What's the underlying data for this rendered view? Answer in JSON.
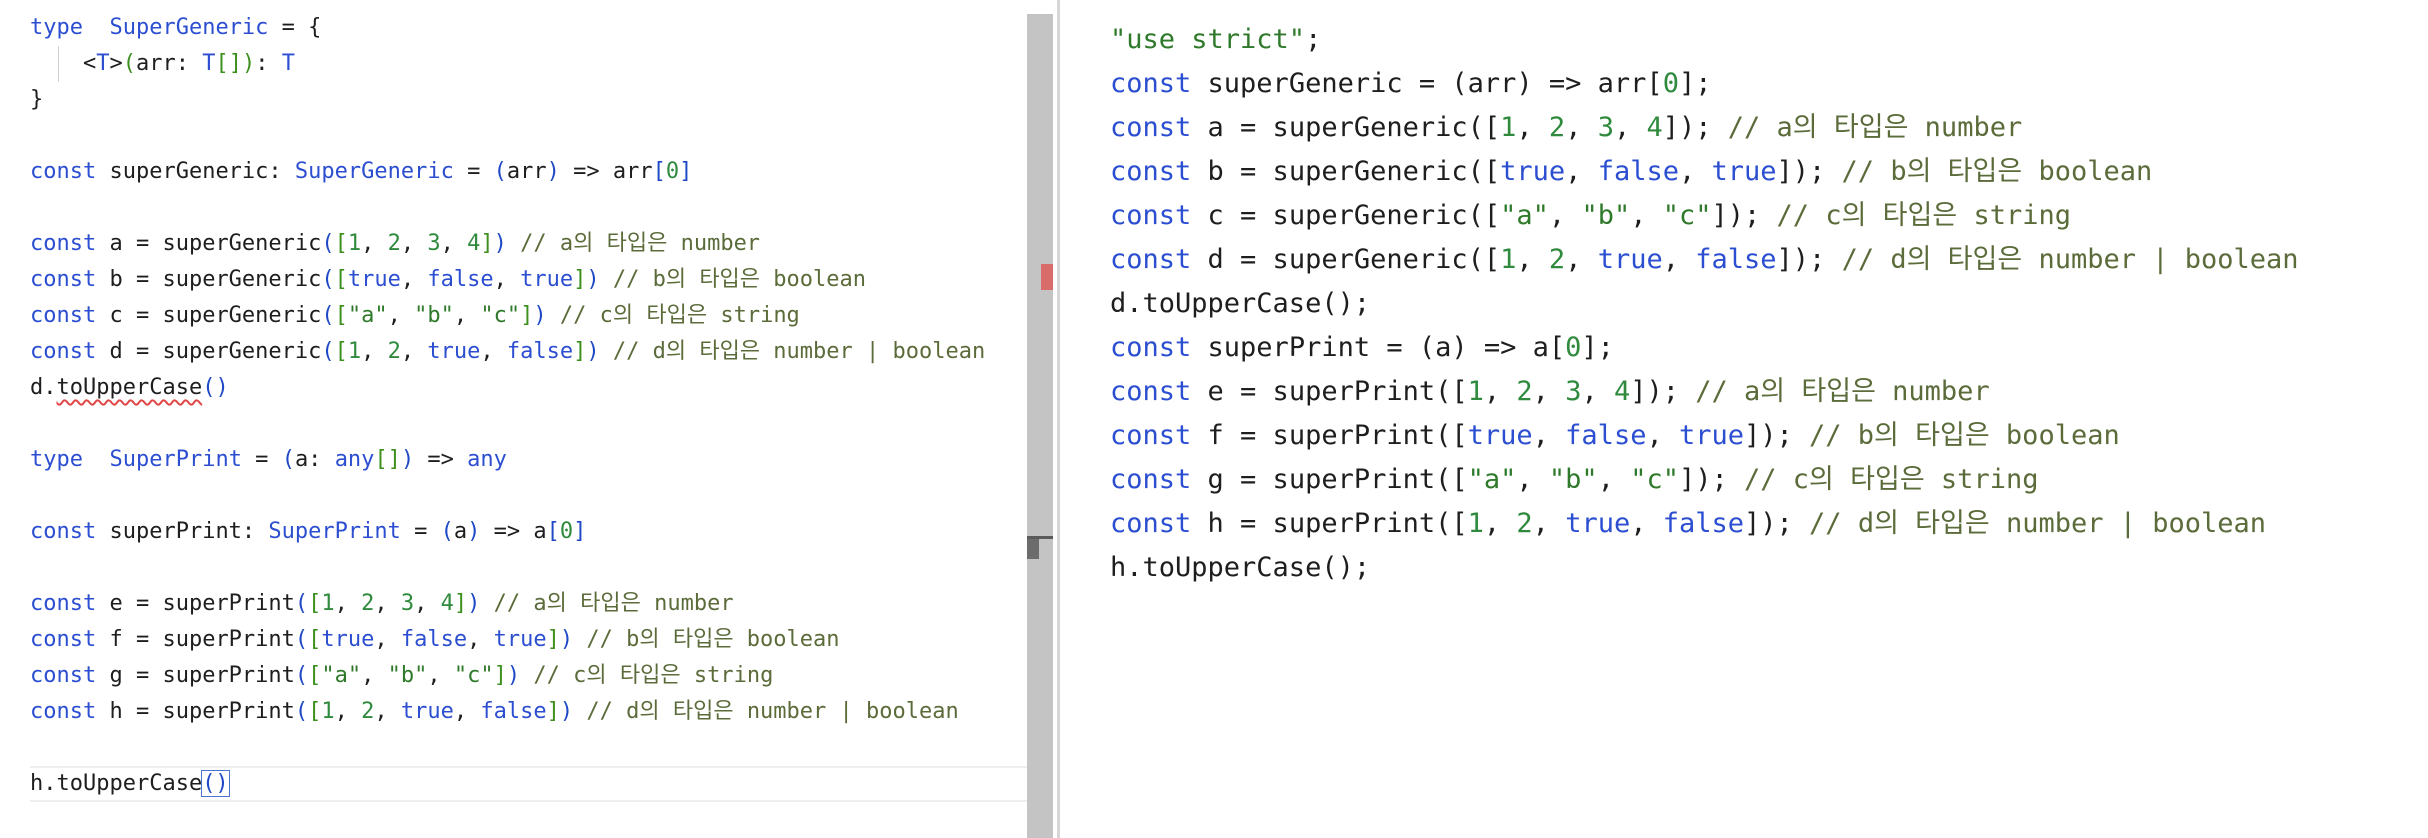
{
  "ts_editor": {
    "lines": [
      [
        [
          "kw",
          "type"
        ],
        [
          "",
          "  "
        ],
        [
          "ty",
          "SuperGeneric"
        ],
        [
          "",
          " = {"
        ]
      ],
      [
        [
          "",
          "    <"
        ],
        [
          "ty",
          "T"
        ],
        [
          "",
          ">"
        ],
        [
          "br2",
          "("
        ],
        [
          "",
          "arr: "
        ],
        [
          "ty",
          "T"
        ],
        [
          "br2",
          "[]"
        ],
        [
          "br2",
          ")"
        ],
        [
          "",
          ": "
        ],
        [
          "ty",
          "T"
        ]
      ],
      [
        [
          "",
          "}"
        ]
      ],
      [],
      [
        [
          "kw",
          "const"
        ],
        [
          "",
          " superGeneric: "
        ],
        [
          "ty",
          "SuperGeneric"
        ],
        [
          "",
          " = "
        ],
        [
          "br1",
          "("
        ],
        [
          "",
          "arr"
        ],
        [
          "br1",
          ")"
        ],
        [
          "",
          " => arr"
        ],
        [
          "br1",
          "["
        ],
        [
          "num",
          "0"
        ],
        [
          "br1",
          "]"
        ]
      ],
      [],
      [
        [
          "kw",
          "const"
        ],
        [
          "",
          " a = superGeneric"
        ],
        [
          "br1",
          "("
        ],
        [
          "br2",
          "["
        ],
        [
          "num",
          "1"
        ],
        [
          "",
          ", "
        ],
        [
          "num",
          "2"
        ],
        [
          "",
          ", "
        ],
        [
          "num",
          "3"
        ],
        [
          "",
          ", "
        ],
        [
          "num",
          "4"
        ],
        [
          "br2",
          "]"
        ],
        [
          "br1",
          ")"
        ],
        [
          "cmt",
          " // a의 타입은 number"
        ]
      ],
      [
        [
          "kw",
          "const"
        ],
        [
          "",
          " b = superGeneric"
        ],
        [
          "br1",
          "("
        ],
        [
          "br2",
          "["
        ],
        [
          "kw",
          "true"
        ],
        [
          "",
          ", "
        ],
        [
          "kw",
          "false"
        ],
        [
          "",
          ", "
        ],
        [
          "kw",
          "true"
        ],
        [
          "br2",
          "]"
        ],
        [
          "br1",
          ")"
        ],
        [
          "cmt",
          " // b의 타입은 boolean"
        ]
      ],
      [
        [
          "kw",
          "const"
        ],
        [
          "",
          " c = superGeneric"
        ],
        [
          "br1",
          "("
        ],
        [
          "br2",
          "["
        ],
        [
          "str",
          "\"a\""
        ],
        [
          "",
          ", "
        ],
        [
          "str",
          "\"b\""
        ],
        [
          "",
          ", "
        ],
        [
          "str",
          "\"c\""
        ],
        [
          "br2",
          "]"
        ],
        [
          "br1",
          ")"
        ],
        [
          "cmt",
          " // c의 타입은 string"
        ]
      ],
      [
        [
          "kw",
          "const"
        ],
        [
          "",
          " d = superGeneric"
        ],
        [
          "br1",
          "("
        ],
        [
          "br2",
          "["
        ],
        [
          "num",
          "1"
        ],
        [
          "",
          ", "
        ],
        [
          "num",
          "2"
        ],
        [
          "",
          ", "
        ],
        [
          "kw",
          "true"
        ],
        [
          "",
          ", "
        ],
        [
          "kw",
          "false"
        ],
        [
          "br2",
          "]"
        ],
        [
          "br1",
          ")"
        ],
        [
          "cmt",
          " // d의 타입은 number | boolean"
        ]
      ],
      [
        [
          "",
          "d."
        ],
        [
          "squiggle",
          "toUpperCase"
        ],
        [
          "br1",
          "()"
        ]
      ],
      [],
      [
        [
          "kw",
          "type"
        ],
        [
          "",
          "  "
        ],
        [
          "ty",
          "SuperPrint"
        ],
        [
          "",
          " = "
        ],
        [
          "br1",
          "("
        ],
        [
          "",
          "a: "
        ],
        [
          "ty",
          "any"
        ],
        [
          "br2",
          "[]"
        ],
        [
          "br1",
          ")"
        ],
        [
          "",
          " => "
        ],
        [
          "ty",
          "any"
        ]
      ],
      [],
      [
        [
          "kw",
          "const"
        ],
        [
          "",
          " superPrint: "
        ],
        [
          "ty",
          "SuperPrint"
        ],
        [
          "",
          " = "
        ],
        [
          "br1",
          "("
        ],
        [
          "",
          "a"
        ],
        [
          "br1",
          ")"
        ],
        [
          "",
          " => a"
        ],
        [
          "br1",
          "["
        ],
        [
          "num",
          "0"
        ],
        [
          "br1",
          "]"
        ]
      ],
      [],
      [
        [
          "kw",
          "const"
        ],
        [
          "",
          " e = superPrint"
        ],
        [
          "br1",
          "("
        ],
        [
          "br2",
          "["
        ],
        [
          "num",
          "1"
        ],
        [
          "",
          ", "
        ],
        [
          "num",
          "2"
        ],
        [
          "",
          ", "
        ],
        [
          "num",
          "3"
        ],
        [
          "",
          ", "
        ],
        [
          "num",
          "4"
        ],
        [
          "br2",
          "]"
        ],
        [
          "br1",
          ")"
        ],
        [
          "cmt",
          " // a의 타입은 number"
        ]
      ],
      [
        [
          "kw",
          "const"
        ],
        [
          "",
          " f = superPrint"
        ],
        [
          "br1",
          "("
        ],
        [
          "br2",
          "["
        ],
        [
          "kw",
          "true"
        ],
        [
          "",
          ", "
        ],
        [
          "kw",
          "false"
        ],
        [
          "",
          ", "
        ],
        [
          "kw",
          "true"
        ],
        [
          "br2",
          "]"
        ],
        [
          "br1",
          ")"
        ],
        [
          "cmt",
          " // b의 타입은 boolean"
        ]
      ],
      [
        [
          "kw",
          "const"
        ],
        [
          "",
          " g = superPrint"
        ],
        [
          "br1",
          "("
        ],
        [
          "br2",
          "["
        ],
        [
          "str",
          "\"a\""
        ],
        [
          "",
          ", "
        ],
        [
          "str",
          "\"b\""
        ],
        [
          "",
          ", "
        ],
        [
          "str",
          "\"c\""
        ],
        [
          "br2",
          "]"
        ],
        [
          "br1",
          ")"
        ],
        [
          "cmt",
          " // c의 타입은 string"
        ]
      ],
      [
        [
          "kw",
          "const"
        ],
        [
          "",
          " h = superPrint"
        ],
        [
          "br1",
          "("
        ],
        [
          "br2",
          "["
        ],
        [
          "num",
          "1"
        ],
        [
          "",
          ", "
        ],
        [
          "num",
          "2"
        ],
        [
          "",
          ", "
        ],
        [
          "kw",
          "true"
        ],
        [
          "",
          ", "
        ],
        [
          "kw",
          "false"
        ],
        [
          "br2",
          "]"
        ],
        [
          "br1",
          ")"
        ],
        [
          "cmt",
          " // d의 타입은 number | boolean"
        ]
      ],
      [],
      [
        [
          "",
          "h.toUpperCase"
        ],
        [
          "caret",
          "()"
        ]
      ]
    ]
  },
  "js_output": {
    "lines": [
      [
        [
          "str",
          "\"use strict\""
        ],
        [
          "",
          ";"
        ]
      ],
      [
        [
          "kw",
          "const"
        ],
        [
          "",
          " superGeneric = (arr) => arr["
        ],
        [
          "num",
          "0"
        ],
        [
          "",
          "];"
        ]
      ],
      [
        [
          "kw",
          "const"
        ],
        [
          "",
          " a = superGeneric(["
        ],
        [
          "num",
          "1"
        ],
        [
          "",
          ", "
        ],
        [
          "num",
          "2"
        ],
        [
          "",
          ", "
        ],
        [
          "num",
          "3"
        ],
        [
          "",
          ", "
        ],
        [
          "num",
          "4"
        ],
        [
          "",
          "]);"
        ],
        [
          "cmt",
          " // a의 타입은 number"
        ]
      ],
      [
        [
          "kw",
          "const"
        ],
        [
          "",
          " b = superGeneric(["
        ],
        [
          "kw",
          "true"
        ],
        [
          "",
          ", "
        ],
        [
          "kw",
          "false"
        ],
        [
          "",
          ", "
        ],
        [
          "kw",
          "true"
        ],
        [
          "",
          "]);"
        ],
        [
          "cmt",
          " // b의 타입은 boolean"
        ]
      ],
      [
        [
          "kw",
          "const"
        ],
        [
          "",
          " c = superGeneric(["
        ],
        [
          "str",
          "\"a\""
        ],
        [
          "",
          ", "
        ],
        [
          "str",
          "\"b\""
        ],
        [
          "",
          ", "
        ],
        [
          "str",
          "\"c\""
        ],
        [
          "",
          "]);"
        ],
        [
          "cmt",
          " // c의 타입은 string"
        ]
      ],
      [
        [
          "kw",
          "const"
        ],
        [
          "",
          " d = superGeneric(["
        ],
        [
          "num",
          "1"
        ],
        [
          "",
          ", "
        ],
        [
          "num",
          "2"
        ],
        [
          "",
          ", "
        ],
        [
          "kw",
          "true"
        ],
        [
          "",
          ", "
        ],
        [
          "kw",
          "false"
        ],
        [
          "",
          "]);"
        ],
        [
          "cmt",
          " // d의 타입은 number | boolean"
        ]
      ],
      [
        [
          "",
          "d.toUpperCase();"
        ]
      ],
      [
        [
          "kw",
          "const"
        ],
        [
          "",
          " superPrint = (a) => a["
        ],
        [
          "num",
          "0"
        ],
        [
          "",
          "];"
        ]
      ],
      [
        [
          "kw",
          "const"
        ],
        [
          "",
          " e = superPrint(["
        ],
        [
          "num",
          "1"
        ],
        [
          "",
          ", "
        ],
        [
          "num",
          "2"
        ],
        [
          "",
          ", "
        ],
        [
          "num",
          "3"
        ],
        [
          "",
          ", "
        ],
        [
          "num",
          "4"
        ],
        [
          "",
          "]);"
        ],
        [
          "cmt",
          " // a의 타입은 number"
        ]
      ],
      [
        [
          "kw",
          "const"
        ],
        [
          "",
          " f = superPrint(["
        ],
        [
          "kw",
          "true"
        ],
        [
          "",
          ", "
        ],
        [
          "kw",
          "false"
        ],
        [
          "",
          ", "
        ],
        [
          "kw",
          "true"
        ],
        [
          "",
          "]);"
        ],
        [
          "cmt",
          " // b의 타입은 boolean"
        ]
      ],
      [
        [
          "kw",
          "const"
        ],
        [
          "",
          " g = superPrint(["
        ],
        [
          "str",
          "\"a\""
        ],
        [
          "",
          ", "
        ],
        [
          "str",
          "\"b\""
        ],
        [
          "",
          ", "
        ],
        [
          "str",
          "\"c\""
        ],
        [
          "",
          "]);"
        ],
        [
          "cmt",
          " // c의 타입은 string"
        ]
      ],
      [
        [
          "kw",
          "const"
        ],
        [
          "",
          " h = superPrint(["
        ],
        [
          "num",
          "1"
        ],
        [
          "",
          ", "
        ],
        [
          "num",
          "2"
        ],
        [
          "",
          ", "
        ],
        [
          "kw",
          "true"
        ],
        [
          "",
          ", "
        ],
        [
          "kw",
          "false"
        ],
        [
          "",
          "]);"
        ],
        [
          "cmt",
          " // d의 타입은 number | boolean"
        ]
      ],
      [
        [
          "",
          "h.toUpperCase();"
        ]
      ]
    ]
  },
  "colors": {
    "keyword": "#2c4ed0",
    "number": "#2f8a3e",
    "string": "#2f7a2a",
    "comment": "#5b6b3a",
    "error": "#d96b6b",
    "scrollbar": "#c4c4c4"
  }
}
